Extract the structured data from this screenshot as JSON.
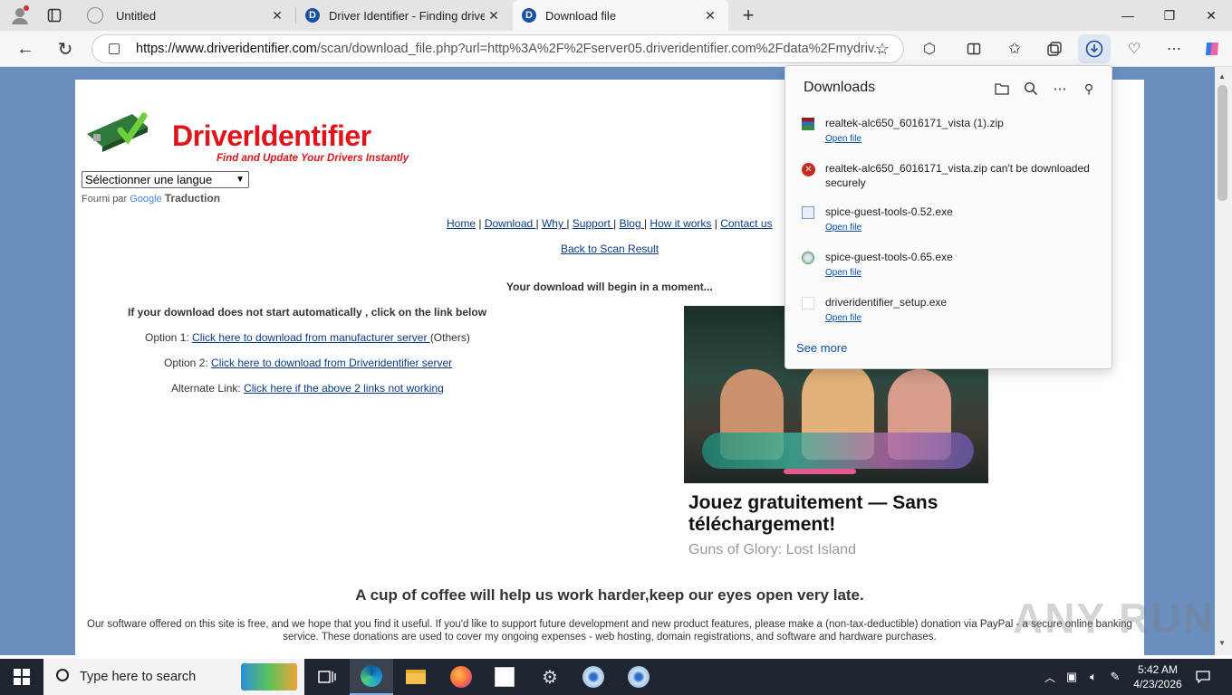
{
  "tabs": [
    {
      "title": "Untitled"
    },
    {
      "title": "Driver Identifier - Finding drivers f"
    },
    {
      "title": "Download file"
    }
  ],
  "address": {
    "url_host": "https://www.driveridentifier.com",
    "url_rest": "/scan/download_file.php?url=http%3A%2F%2Fserver05.driveridentifier.com%2Fdata%2Fmydriv..."
  },
  "site": {
    "logo_title": "DriverIdentifier",
    "logo_tagline": "Find and Update Your Drivers Instantly",
    "language_select": "Sélectionner une langue",
    "powered_by": "Fourni par",
    "google": "Google",
    "translate": "Traduction",
    "nav": [
      "Home",
      "Download ",
      "Why ",
      "Support ",
      "Blog ",
      "How it works",
      "Contact us"
    ],
    "back_link": "Back to Scan Result",
    "download_msg": "Your download will begin in a moment...",
    "not_start_msg": "If your download does not start automatically , click on the link below",
    "option1_label": "Option 1: ",
    "option1_link": "Click here to download from manufacturer server ",
    "option1_suffix": "(Others)",
    "option2_label": "Option 2: ",
    "option2_link": "Click here to download from Driveridentifier server",
    "alt_label": "Alternate Link: ",
    "alt_link": "Click here if the above 2 links not working",
    "ad_headline": "Jouez gratuitement — Sans téléchargement!",
    "ad_sub": "Guns of Glory: Lost Island",
    "coffee": "A cup of coffee will help us work harder,keep our eyes open very late.",
    "donate_text": "Our software offered on this site is free, and we hope that you find it useful. If you'd like to support future development and new product features, please make a (non-tax-deductible) donation via PayPal - a secure online banking service. These donations are used to cover my ongoing expenses - web hosting, domain registrations, and software and hardware purchases."
  },
  "downloads": {
    "title": "Downloads",
    "items": [
      {
        "name": "realtek-alc650_6016171_vista (1).zip",
        "action": "Open file",
        "icon": "archive-icon"
      },
      {
        "name": "realtek-alc650_6016171_vista.zip can't be downloaded securely",
        "action": "",
        "icon": "error-icon"
      },
      {
        "name": "spice-guest-tools-0.52.exe",
        "action": "Open file",
        "icon": "installer-icon"
      },
      {
        "name": "spice-guest-tools-0.65.exe",
        "action": "Open file",
        "icon": "installer-icon"
      },
      {
        "name": "driveridentifier_setup.exe",
        "action": "Open file",
        "icon": "file-icon"
      }
    ],
    "see_more": "See more"
  },
  "taskbar": {
    "search_placeholder": "Type here to search",
    "time": "5:42 AM",
    "date": "4/23/2026"
  },
  "watermark": "ANY RUN",
  "colors": {
    "accent": "#0a3a8a",
    "logo_red": "#e0151b",
    "viewport_bg": "#6a8fbf",
    "taskbar_bg": "#1f2530"
  }
}
